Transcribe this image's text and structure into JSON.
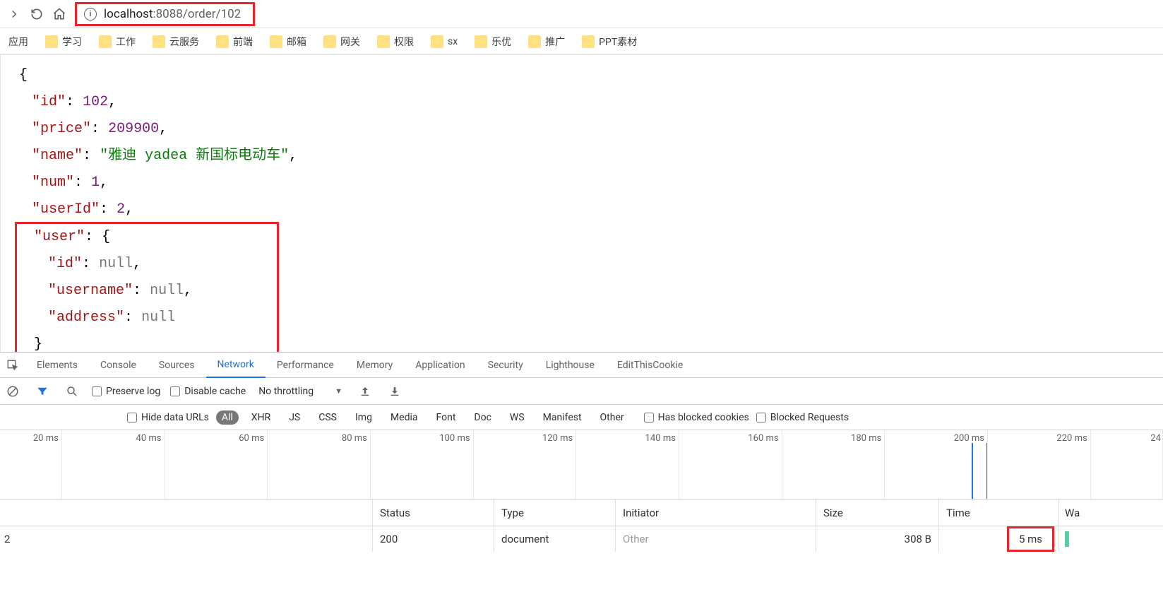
{
  "browser": {
    "url_host": "localhost",
    "url_port": ":8088",
    "url_path": "/order/102"
  },
  "bookmarks": [
    {
      "label": "应用",
      "no_icon": true
    },
    {
      "label": "学习"
    },
    {
      "label": "工作"
    },
    {
      "label": "云服务"
    },
    {
      "label": "前端"
    },
    {
      "label": "邮箱"
    },
    {
      "label": "网关"
    },
    {
      "label": "权限"
    },
    {
      "label": "sx"
    },
    {
      "label": "乐优"
    },
    {
      "label": "推广"
    },
    {
      "label": "PPT素材"
    }
  ],
  "json_data": {
    "id": 102,
    "price": 209900,
    "name": "\"雅迪 yadea 新国标电动车\"",
    "num": 1,
    "userId": 2,
    "user": {
      "id": "null",
      "username": "null",
      "address": "null"
    }
  },
  "devtools": {
    "tabs": [
      "Elements",
      "Console",
      "Sources",
      "Network",
      "Performance",
      "Memory",
      "Application",
      "Security",
      "Lighthouse",
      "EditThisCookie"
    ],
    "active_tab": "Network",
    "preserve_log": "Preserve log",
    "disable_cache": "Disable cache",
    "throttling": "No throttling",
    "hide_data_urls": "Hide data URLs",
    "filters": [
      "All",
      "XHR",
      "JS",
      "CSS",
      "Img",
      "Media",
      "Font",
      "Doc",
      "WS",
      "Manifest",
      "Other"
    ],
    "active_filter": "All",
    "has_blocked": "Has blocked cookies",
    "blocked_req": "Blocked Requests",
    "timeline_ticks": [
      "20 ms",
      "40 ms",
      "60 ms",
      "80 ms",
      "100 ms",
      "120 ms",
      "140 ms",
      "160 ms",
      "180 ms",
      "200 ms",
      "220 ms",
      "24"
    ],
    "table": {
      "headers": {
        "name": "",
        "status": "Status",
        "type": "Type",
        "initiator": "Initiator",
        "size": "Size",
        "time": "Time",
        "waterfall": "Wa"
      },
      "rows": [
        {
          "name": "2",
          "status": "200",
          "type": "document",
          "initiator": "Other",
          "size": "308 B",
          "time": "5 ms"
        }
      ]
    }
  }
}
